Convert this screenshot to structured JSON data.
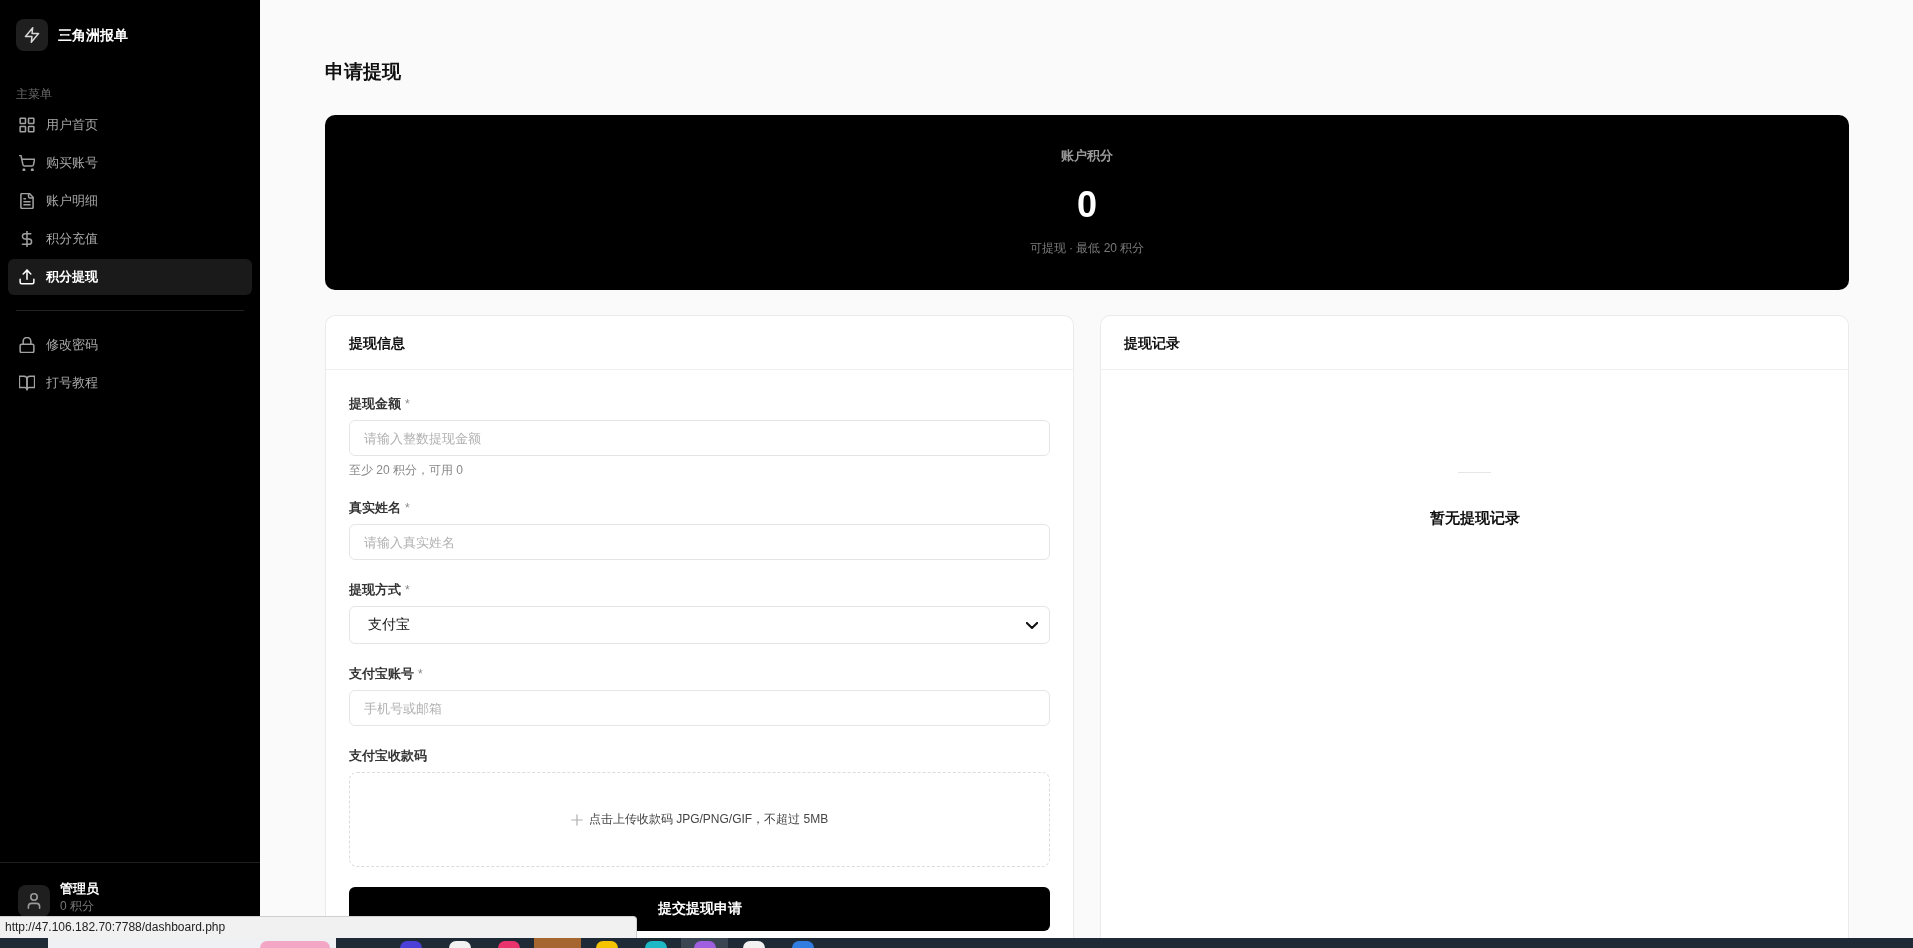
{
  "sidebar": {
    "brand": "三角洲报单",
    "section_title": "主菜单",
    "items": [
      {
        "label": "用户首页",
        "selected": false
      },
      {
        "label": "购买账号",
        "selected": false
      },
      {
        "label": "账户明细",
        "selected": false
      },
      {
        "label": "积分充值",
        "selected": false
      },
      {
        "label": "积分提现",
        "selected": true
      }
    ],
    "secondary_items": [
      {
        "label": "修改密码",
        "selected": false
      },
      {
        "label": "打号教程",
        "selected": false
      }
    ],
    "user": {
      "name": "管理员",
      "points": "0 积分"
    }
  },
  "page": {
    "title": "申请提现",
    "balance_card": {
      "label": "账户积分",
      "value": "0",
      "note": "可提现 · 最低 20 积分"
    },
    "form_card": {
      "title": "提现信息",
      "fields": [
        {
          "kind": "input",
          "label": "提现金额",
          "required_mark": "*",
          "placeholder": "请输入整数提现金额",
          "hint": "至少 20 积分，可用 0"
        },
        {
          "kind": "input",
          "label": "真实姓名",
          "required_mark": "*",
          "placeholder": "请输入真实姓名"
        },
        {
          "kind": "select",
          "label": "提现方式",
          "required_mark": "*",
          "value": "支付宝"
        },
        {
          "kind": "input",
          "label": "支付宝账号",
          "required_mark": "*",
          "placeholder": "手机号或邮箱"
        },
        {
          "kind": "upload",
          "label": "支付宝收款码",
          "text": "点击上传收款码 JPG/PNG/GIF，不超过 5MB"
        }
      ],
      "submit": "提交提现申请"
    },
    "records_card": {
      "title": "提现记录",
      "empty_text": "暂无提现记录"
    }
  },
  "browser_status": {
    "url": "http://47.106.182.70:7788/dashboard.php"
  },
  "taskbar": {
    "apps": [
      {
        "color": "#4a3fd6",
        "selected": false,
        "attention": false
      },
      {
        "color": "#f2f2f2",
        "selected": false,
        "attention": false
      },
      {
        "color": "#e8336d",
        "selected": false,
        "attention": false
      },
      {
        "selected": false,
        "attention": true
      },
      {
        "color": "#f5c400",
        "selected": false,
        "attention": false
      },
      {
        "color": "#1cb8c6",
        "selected": false,
        "attention": false
      },
      {
        "color": "#9f5fe0",
        "selected": true,
        "attention": false
      },
      {
        "color": "#f2f2f2",
        "selected": false,
        "attention": false
      },
      {
        "color": "#2f7de1",
        "selected": false,
        "attention": false
      }
    ]
  }
}
